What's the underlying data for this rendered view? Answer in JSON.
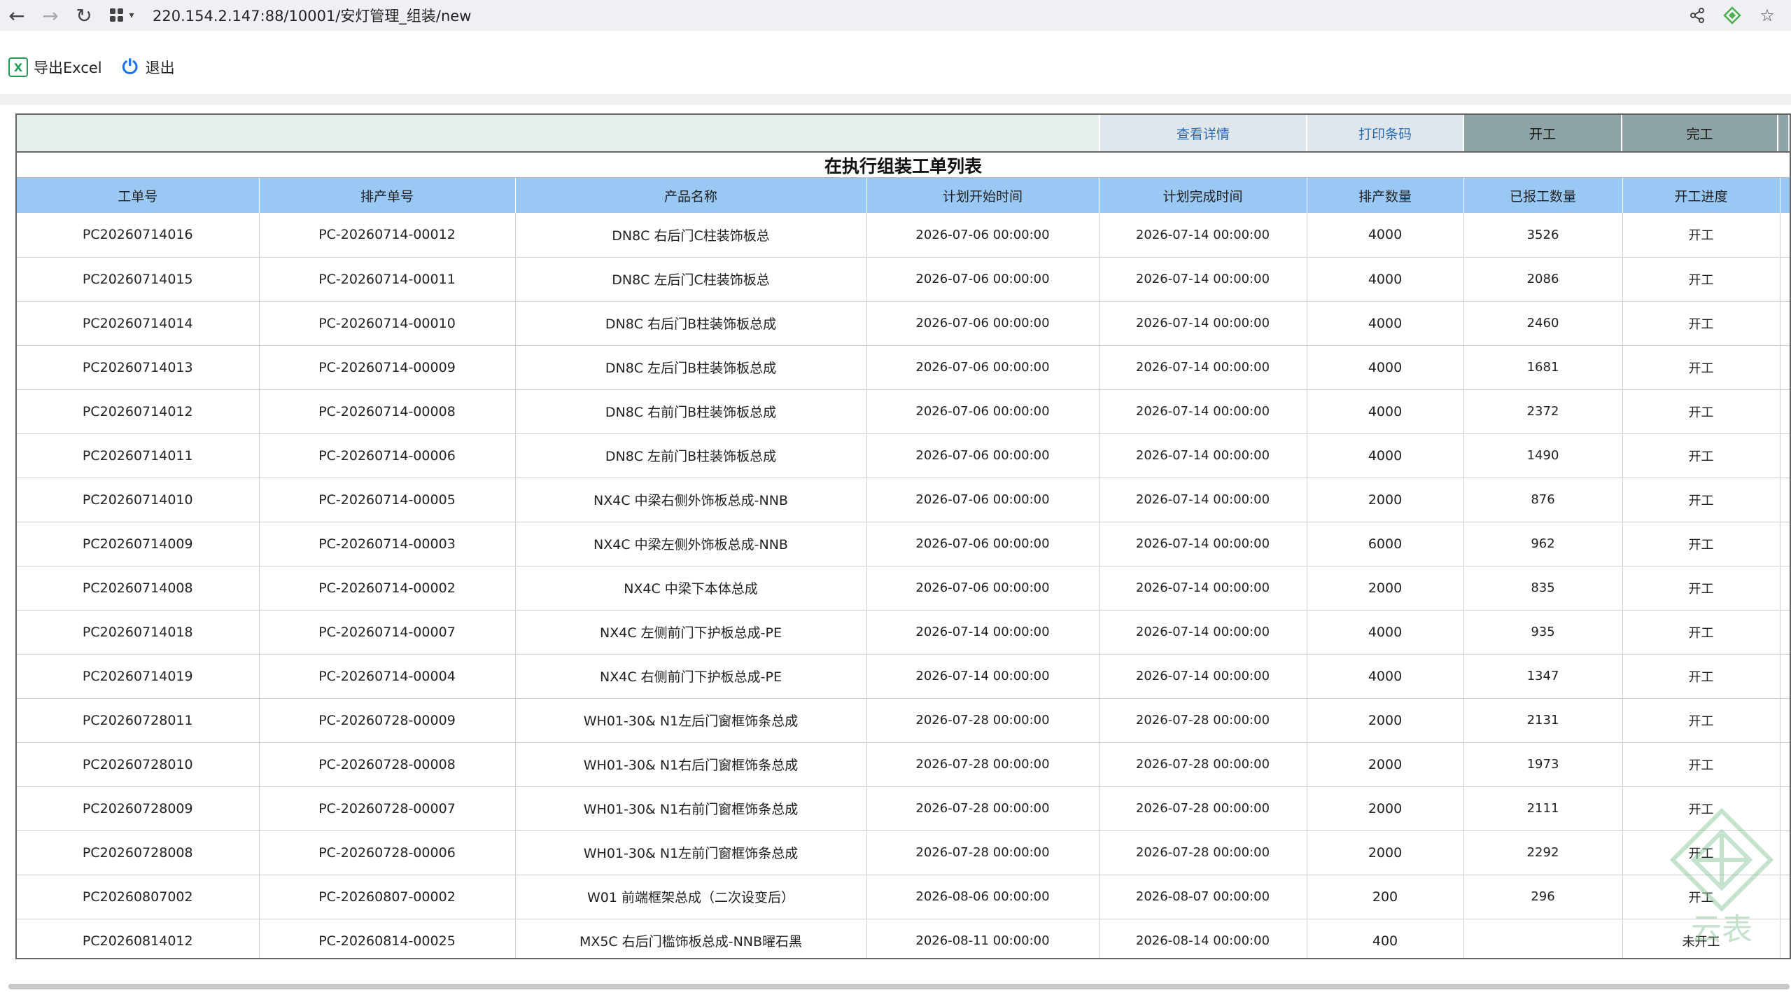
{
  "browser": {
    "url": "220.154.2.147:88/10001/安灯管理_组装/new"
  },
  "toolbar": {
    "export_label": "导出Excel",
    "logout_label": "退出"
  },
  "actions": {
    "details": "查看详情",
    "print": "打印条码",
    "start": "开工",
    "finish": "完工"
  },
  "table": {
    "title": "在执行组装工单列表",
    "headers": [
      "工单号",
      "排产单号",
      "产品名称",
      "计划开始时间",
      "计划完成时间",
      "排产数量",
      "已报工数量",
      "开工进度"
    ],
    "rows": [
      [
        "PC20260714016",
        "PC-20260714-00012",
        "DN8C 右后门C柱装饰板总",
        "2026-07-06 00:00:00",
        "2026-07-14 00:00:00",
        "4000",
        "3526",
        "开工"
      ],
      [
        "PC20260714015",
        "PC-20260714-00011",
        "DN8C 左后门C柱装饰板总",
        "2026-07-06 00:00:00",
        "2026-07-14 00:00:00",
        "4000",
        "2086",
        "开工"
      ],
      [
        "PC20260714014",
        "PC-20260714-00010",
        "DN8C 右后门B柱装饰板总成",
        "2026-07-06 00:00:00",
        "2026-07-14 00:00:00",
        "4000",
        "2460",
        "开工"
      ],
      [
        "PC20260714013",
        "PC-20260714-00009",
        "DN8C 左后门B柱装饰板总成",
        "2026-07-06 00:00:00",
        "2026-07-14 00:00:00",
        "4000",
        "1681",
        "开工"
      ],
      [
        "PC20260714012",
        "PC-20260714-00008",
        "DN8C 右前门B柱装饰板总成",
        "2026-07-06 00:00:00",
        "2026-07-14 00:00:00",
        "4000",
        "2372",
        "开工"
      ],
      [
        "PC20260714011",
        "PC-20260714-00006",
        "DN8C 左前门B柱装饰板总成",
        "2026-07-06 00:00:00",
        "2026-07-14 00:00:00",
        "4000",
        "1490",
        "开工"
      ],
      [
        "PC20260714010",
        "PC-20260714-00005",
        "NX4C 中梁右侧外饰板总成-NNB",
        "2026-07-06 00:00:00",
        "2026-07-14 00:00:00",
        "2000",
        "876",
        "开工"
      ],
      [
        "PC20260714009",
        "PC-20260714-00003",
        "NX4C 中梁左侧外饰板总成-NNB",
        "2026-07-06 00:00:00",
        "2026-07-14 00:00:00",
        "6000",
        "962",
        "开工"
      ],
      [
        "PC20260714008",
        "PC-20260714-00002",
        "NX4C 中梁下本体总成",
        "2026-07-06 00:00:00",
        "2026-07-14 00:00:00",
        "2000",
        "835",
        "开工"
      ],
      [
        "PC20260714018",
        "PC-20260714-00007",
        "NX4C 左侧前门下护板总成-PE",
        "2026-07-14 00:00:00",
        "2026-07-14 00:00:00",
        "4000",
        "935",
        "开工"
      ],
      [
        "PC20260714019",
        "PC-20260714-00004",
        "NX4C 右侧前门下护板总成-PE",
        "2026-07-14 00:00:00",
        "2026-07-14 00:00:00",
        "4000",
        "1347",
        "开工"
      ],
      [
        "PC20260728011",
        "PC-20260728-00009",
        "WH01-30& N1左后门窗框饰条总成",
        "2026-07-28 00:00:00",
        "2026-07-28 00:00:00",
        "2000",
        "2131",
        "开工"
      ],
      [
        "PC20260728010",
        "PC-20260728-00008",
        "WH01-30& N1右后门窗框饰条总成",
        "2026-07-28 00:00:00",
        "2026-07-28 00:00:00",
        "2000",
        "1973",
        "开工"
      ],
      [
        "PC20260728009",
        "PC-20260728-00007",
        "WH01-30& N1右前门窗框饰条总成",
        "2026-07-28 00:00:00",
        "2026-07-28 00:00:00",
        "2000",
        "2111",
        "开工"
      ],
      [
        "PC20260728008",
        "PC-20260728-00006",
        "WH01-30& N1左前门窗框饰条总成",
        "2026-07-28 00:00:00",
        "2026-07-28 00:00:00",
        "2000",
        "2292",
        "开工"
      ],
      [
        "PC20260807002",
        "PC-20260807-00002",
        "W01 前端框架总成（二次设变后）",
        "2026-08-06 00:00:00",
        "2026-08-07 00:00:00",
        "200",
        "296",
        "开工"
      ],
      [
        "PC20260814012",
        "PC-20260814-00025",
        "MX5C 右后门槛饰板总成-NNB曜石黑",
        "2026-08-11 00:00:00",
        "2026-08-14 00:00:00",
        "400",
        "",
        "未开工"
      ]
    ]
  },
  "watermark_text": "云表"
}
